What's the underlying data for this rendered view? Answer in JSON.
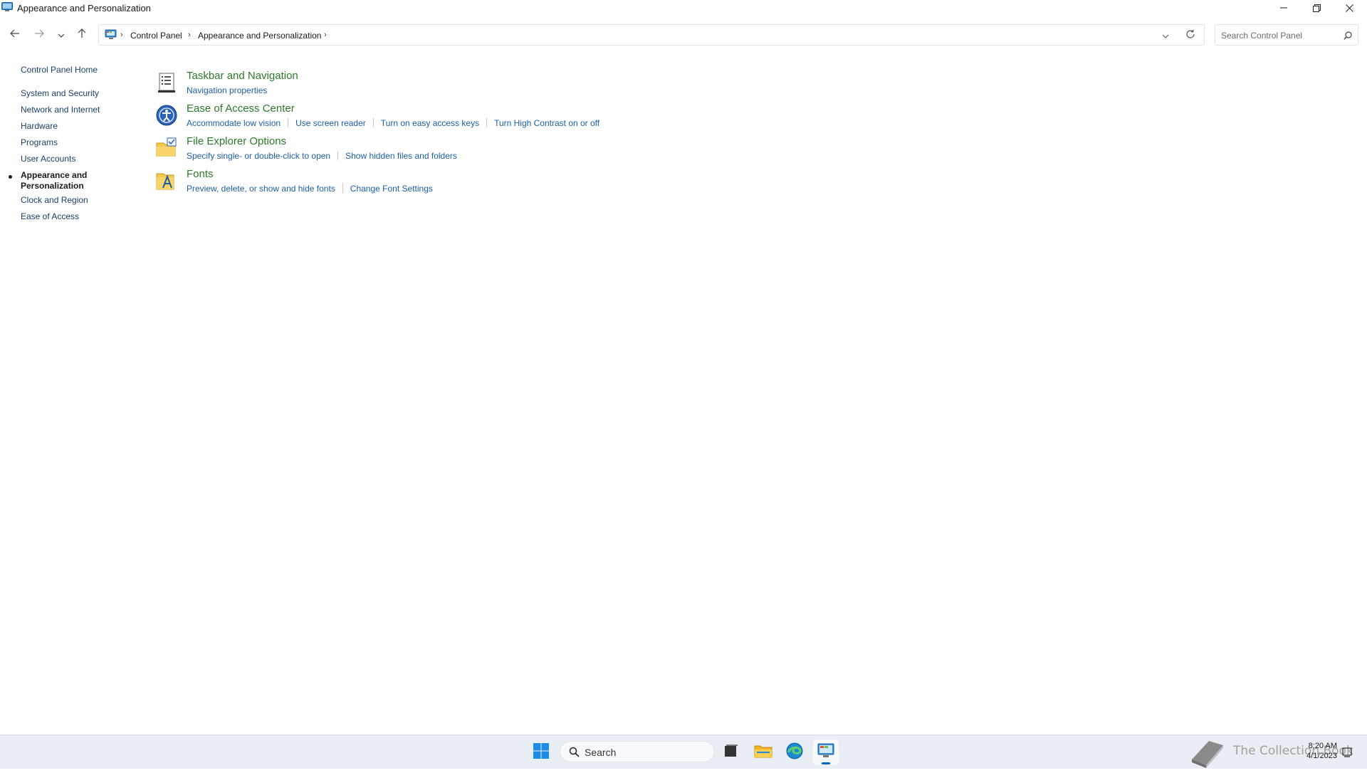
{
  "window": {
    "title": "Appearance and Personalization",
    "controls": [
      "minimize",
      "restore",
      "close"
    ]
  },
  "addressbar": {
    "breadcrumbs": [
      "Control Panel",
      "Appearance and Personalization"
    ],
    "search_placeholder": "Search Control Panel"
  },
  "sidebar": {
    "items": [
      {
        "label": "Control Panel Home"
      },
      {
        "label": "System and Security"
      },
      {
        "label": "Network and Internet"
      },
      {
        "label": "Hardware"
      },
      {
        "label": "Programs"
      },
      {
        "label": "User Accounts"
      },
      {
        "label": "Appearance and",
        "label2": "Personalization",
        "active": true
      },
      {
        "label": "Clock and Region"
      },
      {
        "label": "Ease of Access"
      }
    ]
  },
  "categories": [
    {
      "title": "Taskbar and Navigation",
      "icon": "taskbar-icon",
      "links": [
        "Navigation properties"
      ]
    },
    {
      "title": "Ease of Access Center",
      "icon": "ease-of-access-icon",
      "links": [
        "Accommodate low vision",
        "Use screen reader",
        "Turn on easy access keys",
        "Turn High Contrast on or off"
      ]
    },
    {
      "title": "File Explorer Options",
      "icon": "folder-options-icon",
      "links": [
        "Specify single- or double-click to open",
        "Show hidden files and folders"
      ]
    },
    {
      "title": "Fonts",
      "icon": "fonts-icon",
      "links": [
        "Preview, delete, or show and hide fonts",
        "Change Font Settings"
      ]
    }
  ],
  "taskbar": {
    "search_label": "Search",
    "apps": [
      "windows-start-icon",
      "task-view-icon",
      "file-explorer-icon",
      "edge-icon",
      "control-panel-icon"
    ],
    "watermark_text": "The Collection Book",
    "clock_time": "8:20 AM",
    "clock_date": "4/1/2023"
  },
  "colors": {
    "heading_green": "#2a7a2a",
    "link_blue": "#1b5fa8",
    "nav_blue": "#1b3f68",
    "taskbar_bg": "#e9eef5",
    "accent": "#0067c0"
  }
}
